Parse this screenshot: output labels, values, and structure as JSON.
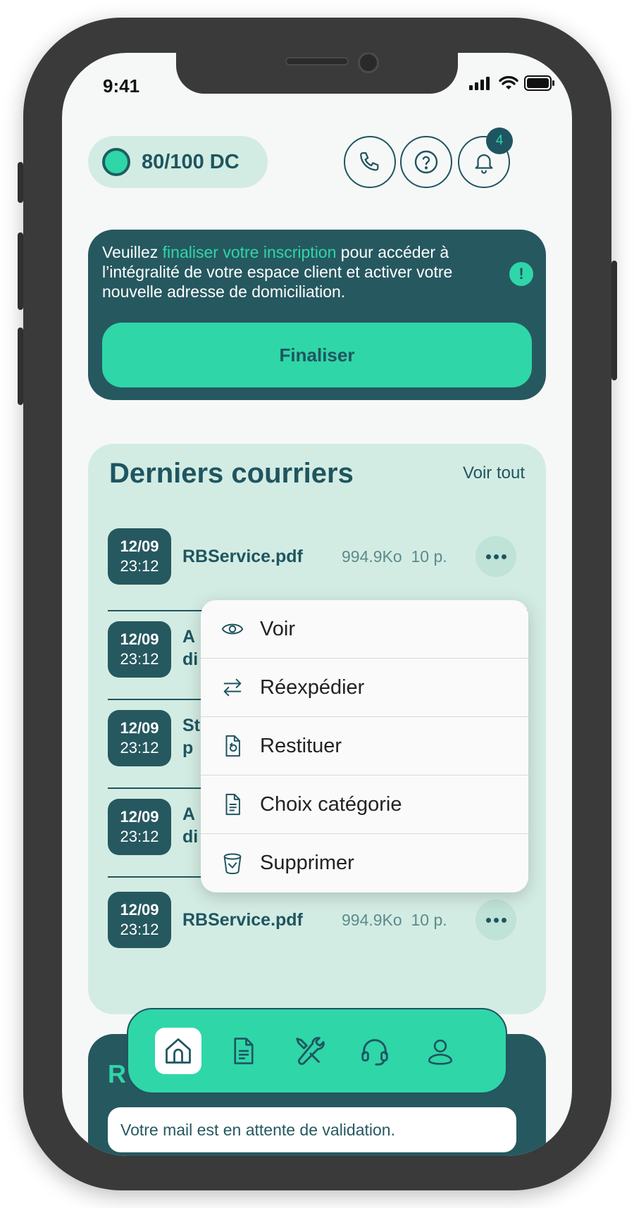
{
  "status_bar": {
    "time": "9:41"
  },
  "credits": {
    "label": "80/100 DC"
  },
  "header": {
    "notifications_count": "4"
  },
  "alert": {
    "text_before": "Veuillez ",
    "highlight": "finaliser votre inscription",
    "text_after": " pour accéder à l’intégralité de votre espace client et activer votre nouvelle adresse de domiciliation.",
    "exclamation": "!",
    "button_label": "Finaliser"
  },
  "mails": {
    "title": "Derniers courriers",
    "see_all": "Voir tout",
    "rows": [
      {
        "date": "12/09",
        "time": "23:12",
        "name": "RBService.pdf",
        "size": "994.9Ko",
        "pages": "10 p."
      },
      {
        "date": "12/09",
        "time": "23:12",
        "name_line1": "A",
        "name_line2": "di"
      },
      {
        "date": "12/09",
        "time": "23:12",
        "name_line1": "St",
        "name_line2": "p"
      },
      {
        "date": "12/09",
        "time": "23:12",
        "name_line1": "A",
        "name_line2": "di"
      },
      {
        "date": "12/09",
        "time": "23:12",
        "name": "RBService.pdf",
        "size": "994.9Ko",
        "pages": "10 p."
      }
    ]
  },
  "context_menu": {
    "items": [
      {
        "label": "Voir",
        "icon": "eye-icon"
      },
      {
        "label": "Réexpédier",
        "icon": "swap-arrows-icon"
      },
      {
        "label": "Restituer",
        "icon": "document-return-icon"
      },
      {
        "label": "Choix catégorie",
        "icon": "document-icon"
      },
      {
        "label": "Supprimer",
        "icon": "trash-icon"
      }
    ]
  },
  "bottom_card": {
    "heading_initial": "R",
    "message": "Votre mail est en attente de validation."
  },
  "tabbar": {
    "tabs": [
      {
        "icon": "home-icon",
        "active": true
      },
      {
        "icon": "document-icon",
        "active": false
      },
      {
        "icon": "tools-icon",
        "active": false
      },
      {
        "icon": "headset-icon",
        "active": false
      },
      {
        "icon": "user-icon",
        "active": false
      }
    ]
  },
  "colors": {
    "primary_dark": "#265860",
    "accent": "#2fd6a8",
    "soft_green": "#d3ece3"
  }
}
